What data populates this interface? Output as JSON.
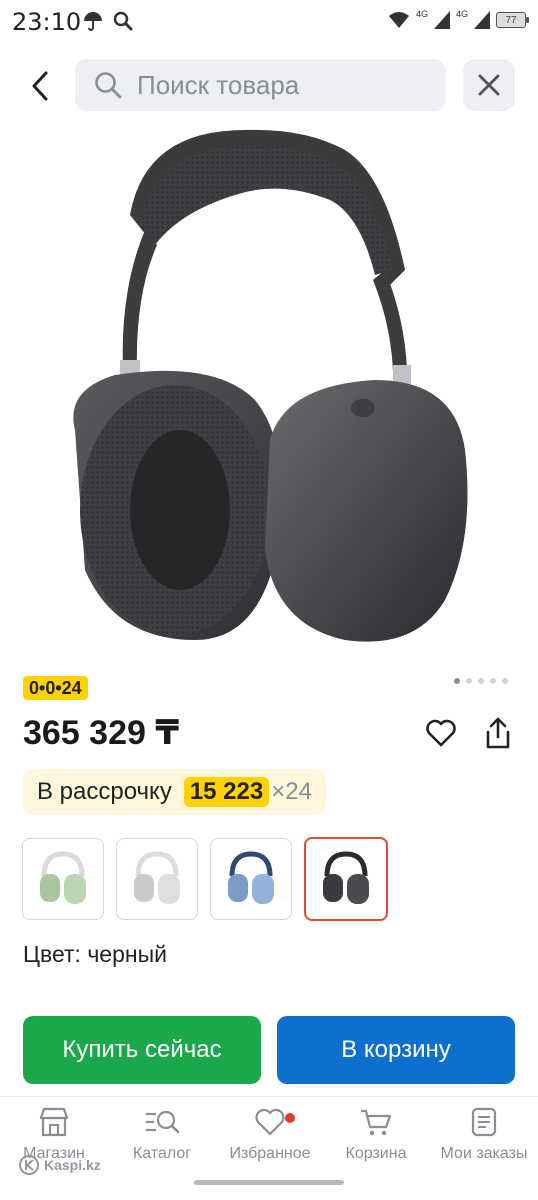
{
  "status_bar": {
    "time": "23:10",
    "network_label_1": "4G",
    "network_label_2": "4G",
    "battery": "77"
  },
  "header": {
    "search_placeholder": "Поиск товара"
  },
  "product": {
    "plan_badge": "0•0•24",
    "price": "365 329 ₸",
    "installment_label": "В рассрочку",
    "installment_amount": "15 223",
    "installment_months": "×24",
    "color_label": "Цвет: черный",
    "carousel": {
      "total": 5,
      "active": 1
    },
    "swatches": [
      {
        "name": "green",
        "color": "#b9d3b1"
      },
      {
        "name": "silver",
        "color": "#d6d7d9"
      },
      {
        "name": "sky-blue",
        "color": "#8fb0d6"
      },
      {
        "name": "black",
        "color": "#3a3b3e",
        "selected": true
      }
    ]
  },
  "actions": {
    "buy_now": "Купить сейчас",
    "add_to_cart": "В корзину"
  },
  "bottom_nav": {
    "items": [
      {
        "label": "Магазин",
        "icon": "store-icon"
      },
      {
        "label": "Каталог",
        "icon": "catalog-search-icon"
      },
      {
        "label": "Избранное",
        "icon": "heart-icon",
        "badge": true
      },
      {
        "label": "Корзина",
        "icon": "cart-icon"
      },
      {
        "label": "Мои заказы",
        "icon": "orders-icon"
      }
    ]
  },
  "watermark": "Kaspi.kz",
  "colors": {
    "buy_now": "#1aa84a",
    "add_to_cart": "#0d6fce",
    "highlight_yellow": "#ffd200",
    "selected_border": "#e24a3b"
  }
}
